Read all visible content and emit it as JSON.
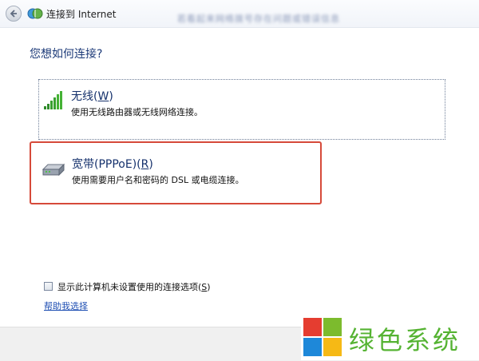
{
  "window": {
    "title": "连接到 Internet",
    "blurred_caption": "若看起来网络拨号存在问题或错误信息"
  },
  "icons": {
    "back": "back-arrow-icon",
    "network": "network-globe-icon",
    "wireless": "signal-bars-icon",
    "broadband": "modem-icon",
    "logo": "windows-logo-icon"
  },
  "main": {
    "question": "您想如何连接?"
  },
  "options": [
    {
      "title_prefix": "无线(",
      "title_accel": "W",
      "title_suffix": ")",
      "description": "使用无线路由器或无线网络连接。"
    },
    {
      "title_prefix": "宽带(PPPoE)(",
      "title_accel": "R",
      "title_suffix": ")",
      "description": "使用需要用户名和密码的 DSL 或电缆连接。"
    }
  ],
  "checkbox": {
    "label_prefix": "显示此计算机未设置使用的连接选项(",
    "label_accel": "S",
    "label_suffix": ")",
    "checked": false
  },
  "help_link": "帮助我选择",
  "watermark": {
    "text": "绿色系统",
    "colors": {
      "red": "#e53d30",
      "green": "#7cbb2d",
      "blue": "#1e88d9",
      "yellow": "#f6b915"
    }
  },
  "colors": {
    "highlight_border": "#d64a3a",
    "title_text": "#15316c",
    "link": "#1f4fb3"
  }
}
